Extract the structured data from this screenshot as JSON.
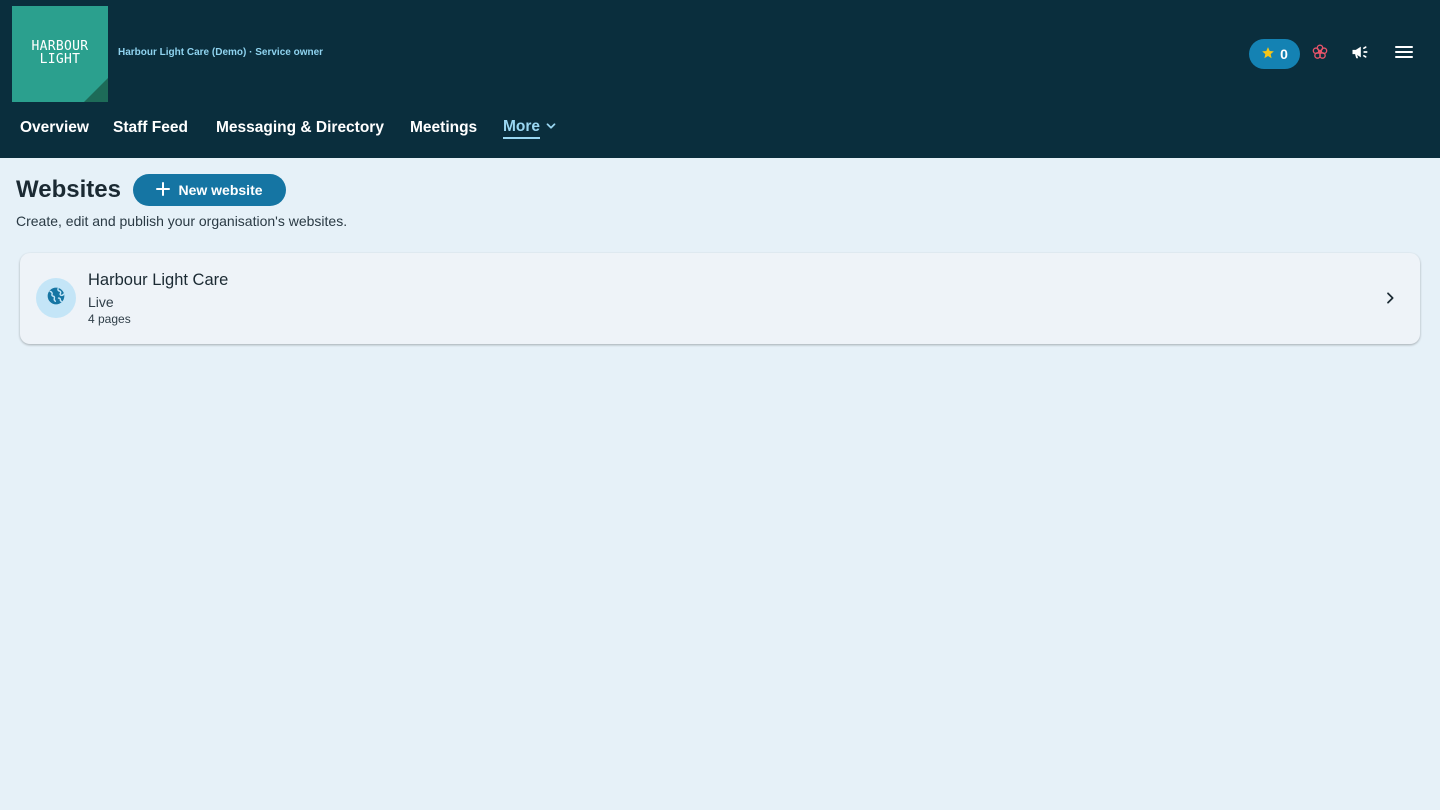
{
  "header": {
    "logo_text": "HARBOUR\nLIGHT",
    "org_line": "Harbour Light Care (Demo) · Service owner",
    "points": "0",
    "icons": {
      "points": "star-icon",
      "care": "flower-icon",
      "announcements": "megaphone-icon",
      "menu": "hamburger-menu-icon"
    },
    "colors": {
      "bar": "#0a2e3d",
      "logo": "#2ba08e",
      "points_pill": "#1482b3",
      "star": "#f5c518",
      "flower": "#e8546a"
    }
  },
  "nav": {
    "items": [
      {
        "label": "Overview"
      },
      {
        "label": "Staff Feed"
      },
      {
        "label": "Messaging & Directory"
      },
      {
        "label": "Meetings"
      }
    ],
    "more_label": "More"
  },
  "main": {
    "title": "Websites",
    "new_button_label": "New website",
    "subtitle": "Create, edit and publish your organisation's websites.",
    "websites": [
      {
        "name": "Harbour Light Care",
        "status": "Live",
        "pages": "4 pages",
        "icon": "globe-icon"
      }
    ]
  }
}
